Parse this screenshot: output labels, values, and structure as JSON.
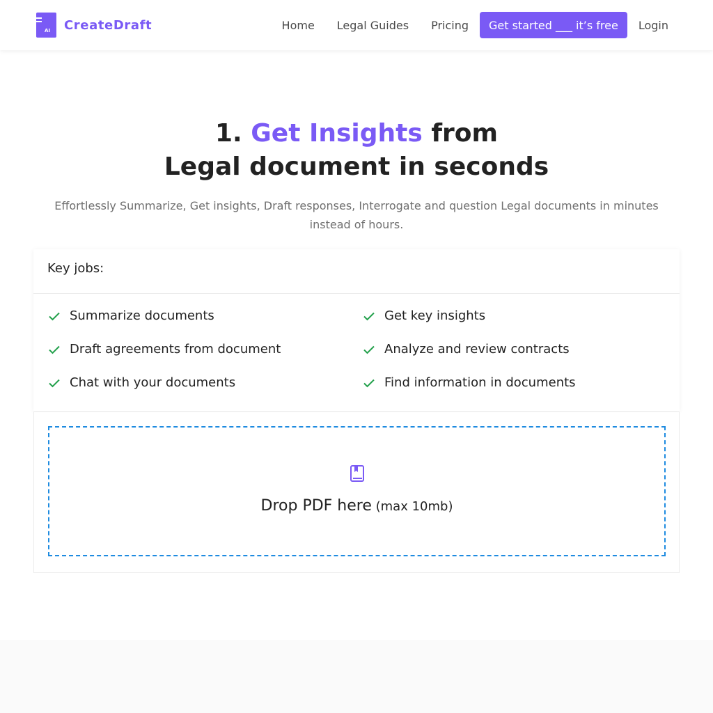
{
  "brand": {
    "name": "CreateDraft",
    "logo_badge": "AI",
    "accent": "#7a5af5"
  },
  "nav": {
    "home": "Home",
    "guides": "Legal Guides",
    "pricing": "Pricing",
    "cta": "Get started ___ it’s free",
    "login": "Login"
  },
  "hero": {
    "prefix": "1. ",
    "accent": "Get Insights",
    "suffix": " from",
    "line2": "Legal document in seconds",
    "subtitle": "Effortlessly Summarize, Get insights, Draft responses, Interrogate and question Legal documents in minutes instead of hours."
  },
  "jobs": {
    "heading": "Key jobs:",
    "check_color": "#22a04b",
    "items": [
      "Summarize documents",
      "Get key insights",
      "Draft agreements from document",
      "Analyze and review contracts",
      "Chat with your documents",
      "Find information in documents"
    ]
  },
  "dropzone": {
    "icon": "book-icon",
    "main": "Drop PDF here",
    "note": " (max 10mb)",
    "border_color": "#1e8be0"
  }
}
